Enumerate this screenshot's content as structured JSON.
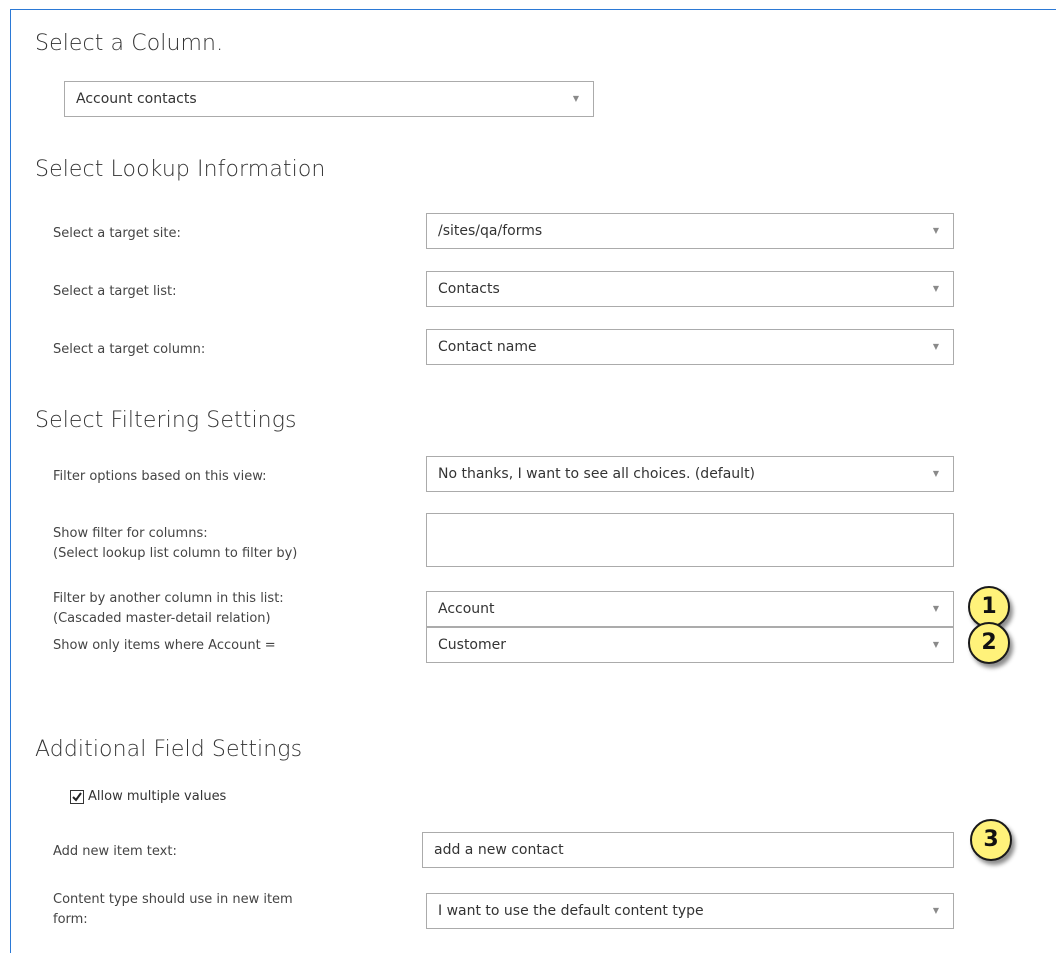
{
  "sections": {
    "column": {
      "title": "Select a Column.",
      "column_select": {
        "value": "Account contacts"
      }
    },
    "lookup": {
      "title": "Select Lookup Information",
      "target_site": {
        "label": "Select a target site:",
        "value": "/sites/qa/forms"
      },
      "target_list": {
        "label": "Select a target list:",
        "value": "Contacts"
      },
      "target_column": {
        "label": "Select a target column:",
        "value": "Contact name"
      }
    },
    "filtering": {
      "title": "Select Filtering Settings",
      "view_filter": {
        "label": "Filter options based on this view:",
        "value": "No thanks, I want to see all choices. (default)"
      },
      "show_filter": {
        "label_line1": "Show filter for columns:",
        "label_line2": "(Select lookup list column to filter by)",
        "value": ""
      },
      "cascade_column": {
        "label_line1": "Filter by another column in this list:",
        "label_line2": "(Cascaded master-detail relation)",
        "value": "Account"
      },
      "match_column": {
        "label": "Show only items where Account =",
        "value": "Customer"
      }
    },
    "additional": {
      "title": "Additional Field Settings",
      "allow_multiple": {
        "label": "Allow multiple values",
        "checked": true
      },
      "new_item_text": {
        "label": "Add new item text:",
        "value": "add a new contact"
      },
      "content_type": {
        "label_line1": "Content type should use in new item",
        "label_line2": "form:",
        "value": "I want to use the default content type"
      }
    }
  },
  "badges": [
    "1",
    "2",
    "3"
  ],
  "icons": {
    "dropdown": "▼",
    "checkmark": "check-icon"
  },
  "colors": {
    "frame_border": "#2b79d6",
    "badge_fill": "#fff27a"
  }
}
